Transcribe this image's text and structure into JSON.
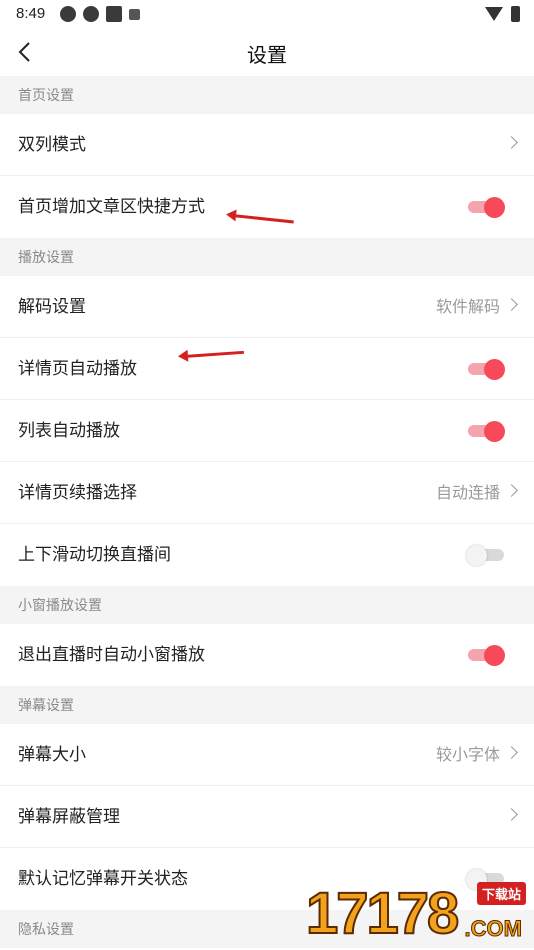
{
  "status_bar": {
    "time": "8:49"
  },
  "header": {
    "title": "设置"
  },
  "sections": [
    {
      "title": "首页设置",
      "rows": [
        {
          "name": "row-dual-column-mode",
          "label": "双列模式",
          "type": "nav",
          "value": ""
        },
        {
          "name": "row-home-article-shortcut",
          "label": "首页增加文章区快捷方式",
          "type": "toggle",
          "on": true
        }
      ]
    },
    {
      "title": "播放设置",
      "rows": [
        {
          "name": "row-decode-settings",
          "label": "解码设置",
          "type": "nav",
          "value": "软件解码"
        },
        {
          "name": "row-detail-autoplay",
          "label": "详情页自动播放",
          "type": "toggle",
          "on": true
        },
        {
          "name": "row-list-autoplay",
          "label": "列表自动播放",
          "type": "toggle",
          "on": true
        },
        {
          "name": "row-detail-continue-play",
          "label": "详情页续播选择",
          "type": "nav",
          "value": "自动连播"
        },
        {
          "name": "row-swipe-switch-live",
          "label": "上下滑动切换直播间",
          "type": "toggle",
          "on": false
        }
      ]
    },
    {
      "title": "小窗播放设置",
      "rows": [
        {
          "name": "row-exit-live-mini-window",
          "label": "退出直播时自动小窗播放",
          "type": "toggle",
          "on": true
        }
      ]
    },
    {
      "title": "弹幕设置",
      "rows": [
        {
          "name": "row-danmaku-size",
          "label": "弹幕大小",
          "type": "nav",
          "value": "较小字体"
        },
        {
          "name": "row-danmaku-block",
          "label": "弹幕屏蔽管理",
          "type": "nav",
          "value": ""
        },
        {
          "name": "row-remember-danmaku-state",
          "label": "默认记忆弹幕开关状态",
          "type": "toggle",
          "on": false
        }
      ]
    },
    {
      "title": "隐私设置",
      "rows": []
    }
  ],
  "watermark": {
    "digits": "17178",
    "badge": "下载站",
    "suffix": ".COM"
  },
  "colors": {
    "toggle_on": "#f64a5a",
    "toggle_track_on": "#f5a3ae",
    "annotation_arrow": "#d52020"
  }
}
